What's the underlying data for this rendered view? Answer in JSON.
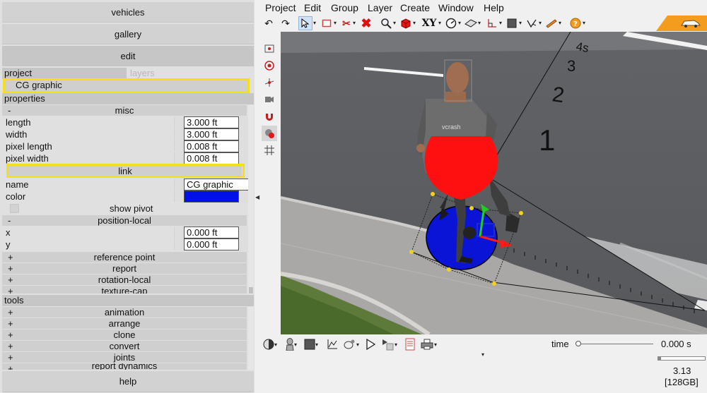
{
  "nav": {
    "vehicles": "vehicles",
    "gallery": "gallery",
    "edit": "edit",
    "help": "help"
  },
  "project": {
    "tab_project": "project",
    "tab_layers": "layers",
    "item": "CG graphic"
  },
  "properties": {
    "header": "properties",
    "misc": {
      "sign": "-",
      "label": "misc",
      "rows": [
        {
          "label": "length",
          "value": "3.000 ft"
        },
        {
          "label": "width",
          "value": "3.000 ft"
        },
        {
          "label": "pixel length",
          "value": "0.008 ft"
        },
        {
          "label": "pixel width",
          "value": "0.008 ft"
        }
      ]
    },
    "link": {
      "label": "link",
      "name_label": "name",
      "name_value": "CG graphic",
      "color_label": "color",
      "color_value": "#0010e6",
      "show_pivot": "show pivot"
    },
    "position_local": {
      "sign": "-",
      "label": "position-local",
      "rows": [
        {
          "label": "x",
          "value": "0.000 ft"
        },
        {
          "label": "y",
          "value": "0.000 ft"
        }
      ]
    },
    "collapsed": [
      {
        "sign": "+",
        "label": "reference point"
      },
      {
        "sign": "+",
        "label": "report"
      },
      {
        "sign": "+",
        "label": "rotation-local"
      },
      {
        "sign": "+",
        "label": "texture-cap"
      }
    ]
  },
  "tools": {
    "header": "tools",
    "items": [
      {
        "sign": "+",
        "label": "animation"
      },
      {
        "sign": "+",
        "label": "arrange"
      },
      {
        "sign": "+",
        "label": "clone"
      },
      {
        "sign": "+",
        "label": "convert"
      },
      {
        "sign": "+",
        "label": "joints"
      },
      {
        "sign": "+",
        "label": "report dynamics"
      }
    ]
  },
  "menubar": [
    "Project",
    "Edit",
    "Group",
    "Layer",
    "Create",
    "Window",
    "Help"
  ],
  "toolbar": {
    "xy_label": "XY"
  },
  "scene": {
    "distance_labels": [
      "1",
      "2",
      "3",
      "4s"
    ],
    "shirt_text": "vcrash"
  },
  "bottom": {
    "time_label": "time",
    "time_value": "0.000 s",
    "version": "3.13",
    "memory": "[128GB]"
  },
  "colors": {
    "highlight": "#f4e017",
    "accent_orange": "#f39c1e",
    "selected_tool": "#cfe2f7"
  }
}
